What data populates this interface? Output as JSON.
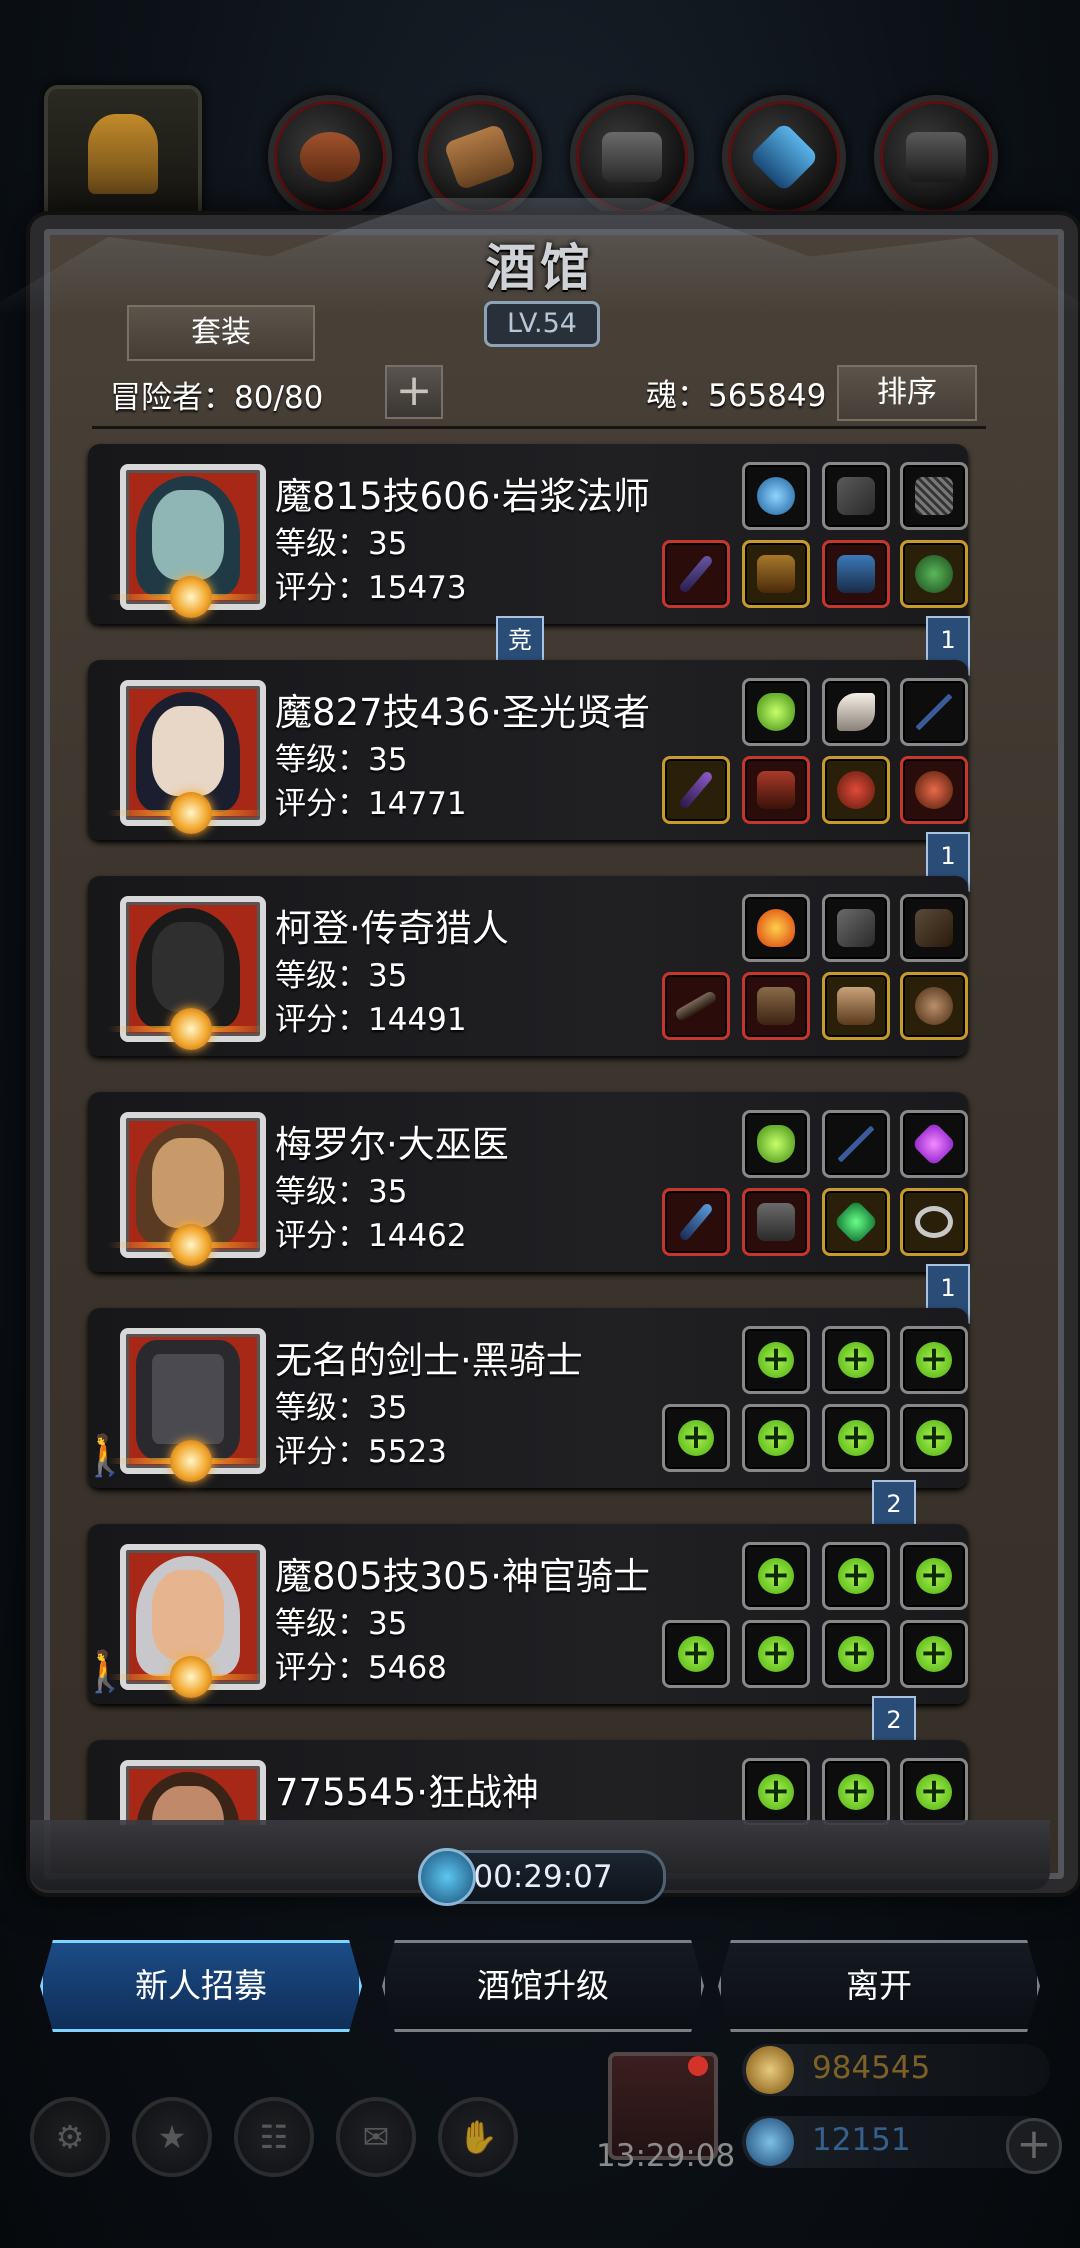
{
  "header": {
    "title": "酒馆",
    "level": "LV.54",
    "suit_button": "套装",
    "adventurers_label": "冒险者：80/80",
    "add_label": "+",
    "soul_label": "魂：565849",
    "sort_button": "排序",
    "top_tabs": [
      "hero-tab",
      "leather-tab",
      "wood-tab",
      "iron-tab",
      "crystal-tab",
      "steel-tab"
    ]
  },
  "heroes": [
    {
      "name": "魔815技606·岩浆法师",
      "level": "等级：35",
      "score": "评分：15473",
      "portrait_color": "#1f3a44",
      "face_color": "#8fb6b4"
    },
    {
      "name": "魔827技436·圣光贤者",
      "level": "等级：35",
      "score": "评分：14771",
      "portrait_color": "#1b1e2e",
      "face_color": "#e8d6c6"
    },
    {
      "name": "柯登·传奇猎人",
      "level": "等级：35",
      "score": "评分：14491",
      "portrait_color": "#1a1a1a",
      "face_color": "#2f2f2f"
    },
    {
      "name": "梅罗尔·大巫医",
      "level": "等级：35",
      "score": "评分：14462",
      "portrait_color": "#5a3a22",
      "face_color": "#c89a6a"
    },
    {
      "name": "无名的剑士·黑骑士",
      "level": "等级：35",
      "score": "评分：5523",
      "portrait_color": "#2a2a2e",
      "face_color": "#4a4a50"
    },
    {
      "name": "魔805技305·神官骑士",
      "level": "等级：35",
      "score": "评分：5468",
      "portrait_color": "#c8c8cc",
      "face_color": "#e6b48e"
    },
    {
      "name": "775545·狂战神",
      "level": "",
      "score": "",
      "portrait_color": "#3a2418",
      "face_color": "#c08a6a"
    }
  ],
  "markers": {
    "arena": "竞",
    "rank1": "1",
    "rank2": "1",
    "rank3": "1",
    "rank4": "2",
    "rank5": "2"
  },
  "timer": "00:29:07",
  "actions": {
    "recruit": "新人招募",
    "upgrade": "酒馆升级",
    "leave": "离开"
  },
  "hud": {
    "gift_timer": "13:29:08",
    "gold": "984545",
    "gems": "12151",
    "gold_color": "#e8b32f",
    "gem_color": "#3c8fd8",
    "accent_recruit": "#5ac8ff"
  }
}
